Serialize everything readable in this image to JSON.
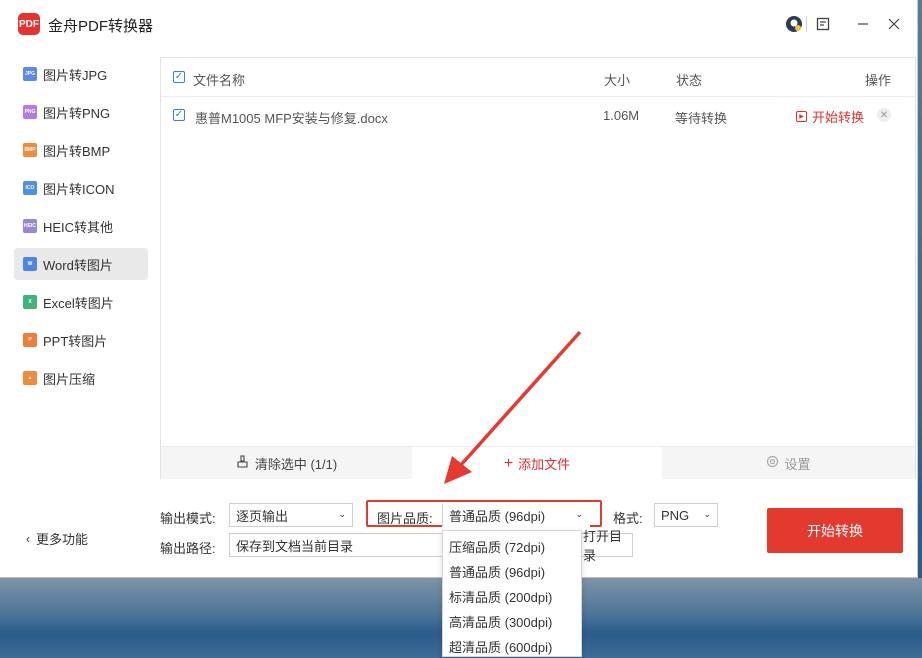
{
  "app": {
    "title": "金舟PDF转换器",
    "logo_text": "PDF"
  },
  "sidebar": {
    "items": [
      {
        "label": "图片转JPG",
        "icon": "jpg-icon",
        "icon_text": "JPG",
        "color": "#5b8be6"
      },
      {
        "label": "图片转PNG",
        "icon": "png-icon",
        "icon_text": "PNG",
        "color": "#b57be0"
      },
      {
        "label": "图片转BMP",
        "icon": "bmp-icon",
        "icon_text": "BMP",
        "color": "#f08a3c"
      },
      {
        "label": "图片转ICON",
        "icon": "ico-icon",
        "icon_text": "ICO",
        "color": "#4e8fe8"
      },
      {
        "label": "HEIC转其他",
        "icon": "heic-icon",
        "icon_text": "HEIC",
        "color": "#9a86d8"
      },
      {
        "label": "Word转图片",
        "icon": "word-icon",
        "icon_text": "W",
        "color": "#4f86e6",
        "active": true
      },
      {
        "label": "Excel转图片",
        "icon": "excel-icon",
        "icon_text": "X",
        "color": "#3fb27f"
      },
      {
        "label": "PPT转图片",
        "icon": "ppt-icon",
        "icon_text": "P",
        "color": "#f07d3c"
      },
      {
        "label": "图片压缩",
        "icon": "compress-icon",
        "icon_text": "▲",
        "color": "#f08a3c"
      }
    ],
    "more_label": "更多功能"
  },
  "file_table": {
    "headers": {
      "name": "文件名称",
      "size": "大小",
      "status": "状态",
      "action": "操作"
    },
    "rows": [
      {
        "name": "惠普M1005 MFP安装与修复.docx",
        "size": "1.06M",
        "status": "等待转换",
        "action": "开始转换"
      }
    ],
    "bottom": {
      "clear": "清除选中 (1/1)",
      "add": "添加文件",
      "settings": "设置"
    }
  },
  "settings": {
    "output_mode_label": "输出模式:",
    "output_mode_value": "逐页输出",
    "quality_label": "图片品质:",
    "quality_value": "普通品质 (96dpi)",
    "format_label": "格式:",
    "format_value": "PNG",
    "path_label": "输出路径:",
    "path_value": "保存到文档当前目录",
    "open_dir_label": "打开目录",
    "start_button": "开始转换"
  },
  "quality_dropdown": {
    "options": [
      "压缩品质 (72dpi)",
      "普通品质 (96dpi)",
      "标清品质 (200dpi)",
      "高清品质 (300dpi)",
      "超清品质 (600dpi)"
    ]
  },
  "colors": {
    "accent": "#e23a2e",
    "checkbox": "#3a7be0"
  }
}
